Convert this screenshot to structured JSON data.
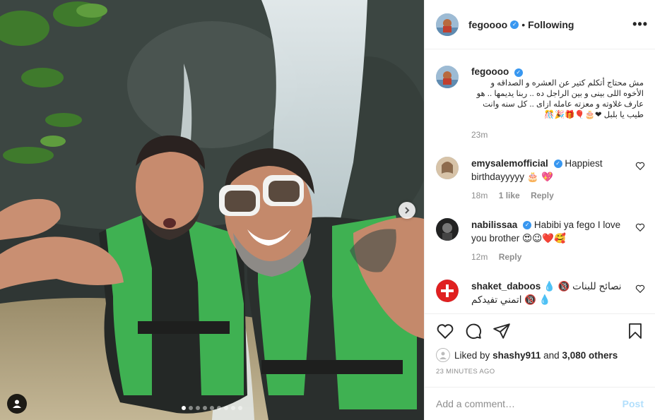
{
  "header": {
    "username": "fegoooo",
    "separator": "•",
    "follow_status": "Following",
    "more": "•••"
  },
  "caption": {
    "username": "fegoooo",
    "text": "مش محتاج أتكلم كتير عن العشره و الصداقه و الأخوه اللى بينى و بين الراجل ده .. ربنا يديمها .. هو عارف غلاوته و معزته عامله ازاى .. كل سنه وانت طيب يا بلبل ❤🎂🎈🎁🎉🎊",
    "time": "23m"
  },
  "comments": [
    {
      "username": "emysalemofficial",
      "text": "Happiest birthdayyyyy 🎂 💖",
      "time": "18m",
      "likes": "1 like",
      "reply": "Reply"
    },
    {
      "username": "nabilissaa",
      "text": "Habibi ya fego I love you brother 😍😉❤️🥰",
      "time": "12m",
      "likes": "",
      "reply": "Reply"
    },
    {
      "username": "shaket_daboos",
      "text": "نصائح للبنات 🔞 💧 اتمني تفيدكم 🔞 💧",
      "time": "",
      "likes": "",
      "reply": ""
    }
  ],
  "likes": {
    "prefix": "Liked by",
    "user": "shashy911",
    "connector": "and",
    "others": "3,080 others"
  },
  "posted_ago": "23 MINUTES AGO",
  "comment_box": {
    "placeholder": "Add a comment…",
    "post_label": "Post"
  },
  "carousel": {
    "total_slides": 9,
    "active_index": 0
  },
  "colors": {
    "verified": "#3897f0",
    "post_disabled": "#b2dffc",
    "muted": "#8e8e8e"
  }
}
